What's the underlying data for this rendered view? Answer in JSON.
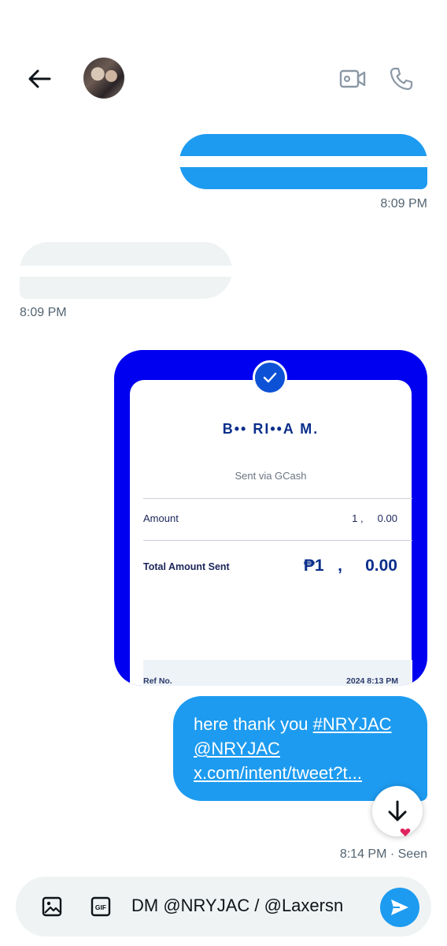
{
  "colors": {
    "accent": "#1d9bf0",
    "receipt_border": "#0000f0",
    "receipt_text": "#0a2e8a",
    "muted": "#536471",
    "bubble_received": "#eff3f4"
  },
  "header": {
    "back_icon": "arrow-left-icon",
    "avatar": "avatar",
    "video_icon": "video-camera-icon",
    "call_icon": "phone-icon"
  },
  "messages": [
    {
      "type": "sent",
      "content": "obscured",
      "time": "8:09 PM"
    },
    {
      "type": "received",
      "content": "obscured",
      "time": "8:09 PM"
    },
    {
      "type": "sent-image",
      "receipt": {
        "recipient": "B•• RI••A M.",
        "via": "Sent via GCash",
        "amount_label": "Amount",
        "amount_value": "1 ,     0.00",
        "total_label": "Total Amount Sent",
        "total_value": "₱1   ,     0.00",
        "ref_label": "Ref No.",
        "date": "2024 8:13 PM"
      }
    },
    {
      "type": "sent",
      "text_plain": "here thank you ",
      "hashtag": "#NRYJAC",
      "mention": "@NRYJAC",
      "link": "x.com/intent/tweet?t...",
      "time": "8:14 PM · Seen"
    }
  ],
  "composer": {
    "image_icon": "image-icon",
    "gif_label": "GIF",
    "input_value": "DM @NRYJAC / @Laxersn",
    "send_icon": "send-icon"
  }
}
